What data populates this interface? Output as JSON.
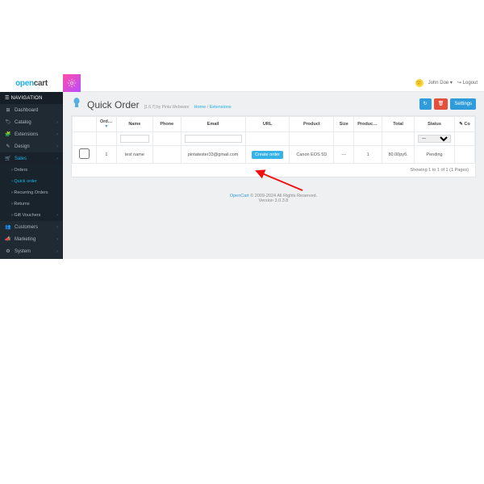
{
  "brand": {
    "name_a": "open",
    "name_b": "cart"
  },
  "topbar": {
    "user": "John Doe",
    "logout": "Logout"
  },
  "sidebar": {
    "heading": "NAVIGATION",
    "items": [
      {
        "icon": "⊞",
        "label": "Dashboard",
        "expand": false
      },
      {
        "icon": "🏷",
        "label": "Catalog",
        "expand": true
      },
      {
        "icon": "🧩",
        "label": "Extensions",
        "expand": true
      },
      {
        "icon": "✎",
        "label": "Design",
        "expand": true
      },
      {
        "icon": "🛒",
        "label": "Sales",
        "expand": true,
        "active": true
      },
      {
        "icon": "👥",
        "label": "Customers",
        "expand": true
      },
      {
        "icon": "📣",
        "label": "Marketing",
        "expand": true
      },
      {
        "icon": "⚙",
        "label": "System",
        "expand": true
      }
    ],
    "sales_sub": [
      {
        "label": "Orders"
      },
      {
        "label": "Quick order",
        "hl": true
      },
      {
        "label": "Recurring Orders"
      },
      {
        "label": "Returns"
      },
      {
        "label": "Gift Vouchers",
        "expand": true
      }
    ]
  },
  "header": {
    "title": "Quick Order",
    "subtitle": "[1.6.7] by Pinta Webware",
    "crumb_home": "Home",
    "crumb_page": "Extensions",
    "btn_refresh": "↻",
    "btn_delete": "🗑",
    "btn_settings": "Settings"
  },
  "table": {
    "cols": {
      "order_id": "Order ID",
      "name": "Name",
      "phone": "Phone",
      "email": "Email",
      "url": "URL",
      "product": "Product",
      "size": "Size",
      "product_amount": "Product amount",
      "total": "Total",
      "status": "Status",
      "comment": "Co"
    },
    "row": {
      "order_id": "1",
      "name": "test name",
      "phone": "",
      "email": "pintatester33@gmail.com",
      "url_btn": "Create order",
      "product": "Canon EOS 5D",
      "size": "---",
      "product_amount": "1",
      "total": "80.00руб.",
      "status": "Pending"
    },
    "pager": "Showing 1 to 1 of 1 (1 Pages)"
  },
  "footer": {
    "link": "OpenCart",
    "copy": " © 2009-2024 All Rights Reserved.",
    "version": "Version 3.0.3.8"
  }
}
